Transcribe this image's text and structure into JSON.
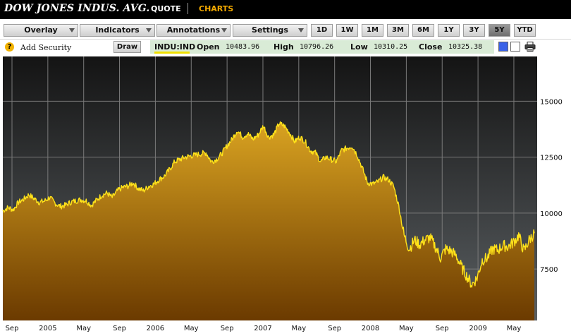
{
  "header": {
    "title": "DOW JONES INDUS. AVG.",
    "tabs": [
      {
        "label": "QUOTE",
        "active": false
      },
      {
        "label": "CHARTS",
        "active": true
      }
    ]
  },
  "toolbar": {
    "menus": [
      "Overlay",
      "Indicators",
      "Annotations",
      "Settings"
    ],
    "ranges": [
      {
        "label": "1D",
        "active": false
      },
      {
        "label": "1W",
        "active": false
      },
      {
        "label": "1M",
        "active": false
      },
      {
        "label": "3M",
        "active": false
      },
      {
        "label": "6M",
        "active": false
      },
      {
        "label": "1Y",
        "active": false
      },
      {
        "label": "3Y",
        "active": false
      },
      {
        "label": "5Y",
        "active": true
      },
      {
        "label": "YTD",
        "active": false
      }
    ]
  },
  "info_row": {
    "help_glyph": "?",
    "add_security": "Add Security",
    "draw_label": "Draw",
    "symbol": "INDU:IND",
    "quote": {
      "open_label": "Open",
      "open": "10483.96",
      "high_label": "High",
      "high": "10796.26",
      "low_label": "Low",
      "low": "10310.25",
      "close_label": "Close",
      "close": "10325.38"
    },
    "icons": [
      "blue-color-swatch-icon",
      "white-color-swatch-icon",
      "printer-icon"
    ]
  },
  "colors": {
    "header_bg": "#000000",
    "charts_tab": "#f2a900",
    "line": "#ffe21a",
    "area_top": "#d9a321",
    "area_bottom": "#6b3a00",
    "bg_top": "#141414",
    "bg_bottom": "#5a5f62",
    "grid": "#7a7a7a",
    "quote_bar_bg": "#d9ebd6"
  },
  "chart_data": {
    "type": "area",
    "title": "",
    "xlabel": "",
    "ylabel": "",
    "ylim": [
      5200,
      17000
    ],
    "y_ticks": [
      7500,
      10000,
      12500,
      15000
    ],
    "x_ticks": [
      "Sep",
      "2005",
      "May",
      "Sep",
      "2006",
      "May",
      "Sep",
      "2007",
      "May",
      "Sep",
      "2008",
      "May",
      "Sep",
      "2009",
      "May"
    ],
    "grid": true,
    "series": [
      {
        "values": [
          10100,
          10250,
          10150,
          10480,
          10620,
          10820,
          10650,
          10480,
          10540,
          10700,
          10450,
          10300,
          10350,
          10480,
          10550,
          10600,
          10550,
          10350,
          10580,
          10800,
          10900,
          10700,
          11000,
          11150,
          11200,
          11350,
          11100,
          11000,
          11200,
          11300,
          11500,
          11650,
          11950,
          12300,
          12400,
          12500,
          12550,
          12600,
          12650,
          12700,
          12300,
          12400,
          12650,
          13000,
          13300,
          13700,
          13400,
          13550,
          13300,
          13500,
          13900,
          13400,
          13500,
          14000,
          13900,
          13600,
          13200,
          13400,
          13200,
          12800,
          12700,
          12300,
          12500,
          12400,
          12300,
          12800,
          12900,
          13000,
          12600,
          12000,
          11350,
          11300,
          11400,
          11600,
          11500,
          11200,
          10300,
          9000,
          8400,
          8800,
          8600,
          8800,
          8900,
          8500,
          8000,
          8400,
          8300,
          8100,
          7600,
          7200,
          6800,
          7100,
          7900,
          8000,
          8400,
          8350,
          8550,
          8500,
          8700,
          9000,
          8300,
          8800,
          9100
        ]
      }
    ]
  }
}
